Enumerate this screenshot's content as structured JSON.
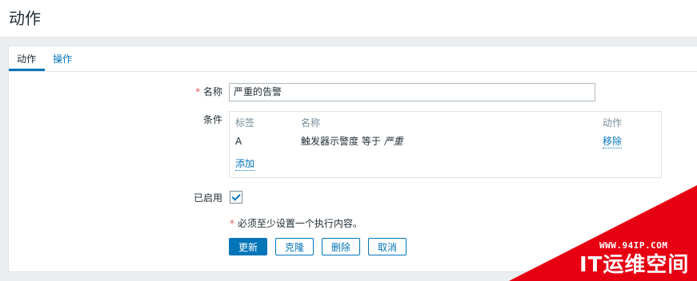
{
  "header": {
    "title": "动作"
  },
  "tabs": [
    {
      "label": "动作"
    },
    {
      "label": "操作"
    }
  ],
  "form": {
    "name": {
      "required_mark": "*",
      "label": "名称",
      "value": "严重的告警"
    },
    "conditions": {
      "label": "条件",
      "columns": [
        "标签",
        "名称",
        "动作"
      ],
      "rows": [
        {
          "tag": "A",
          "name": "触发器示警度 等于",
          "value": "严重",
          "action": "移除"
        }
      ],
      "add_label": "添加"
    },
    "enabled": {
      "label": "已启用",
      "checked": true
    },
    "note": {
      "required_mark": "*",
      "text": "必须至少设置一个执行内容。"
    }
  },
  "buttons": {
    "update": "更新",
    "clone": "克隆",
    "delete": "删除",
    "cancel": "取消"
  },
  "watermark": {
    "url": "WWW.94IP.COM",
    "brand": "IT运维空间"
  },
  "colors": {
    "accent": "#0275b8",
    "required": "#e45959",
    "watermark": "#e60012"
  }
}
